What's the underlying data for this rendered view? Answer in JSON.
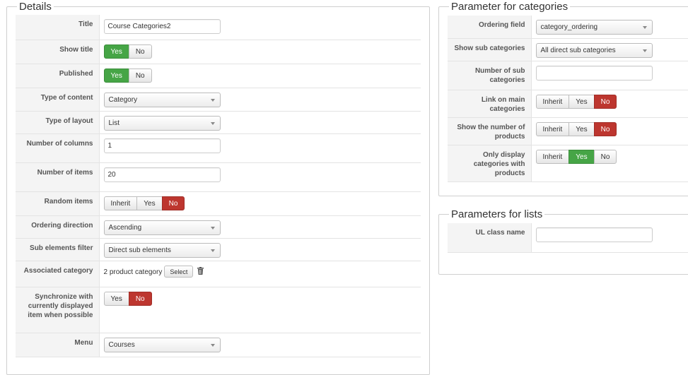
{
  "details": {
    "legend": "Details",
    "title": {
      "label": "Title",
      "value": "Course Categories2"
    },
    "show_title": {
      "label": "Show title",
      "options": [
        "Yes",
        "No"
      ],
      "selected": "Yes"
    },
    "published": {
      "label": "Published",
      "options": [
        "Yes",
        "No"
      ],
      "selected": "Yes"
    },
    "type_of_content": {
      "label": "Type of content",
      "value": "Category"
    },
    "type_of_layout": {
      "label": "Type of layout",
      "value": "List"
    },
    "number_of_columns": {
      "label": "Number of columns",
      "value": "1"
    },
    "number_of_items": {
      "label": "Number of items",
      "value": "20"
    },
    "random_items": {
      "label": "Random items",
      "options": [
        "Inherit",
        "Yes",
        "No"
      ],
      "selected": "No"
    },
    "ordering_direction": {
      "label": "Ordering direction",
      "value": "Ascending"
    },
    "sub_elements_filter": {
      "label": "Sub elements filter",
      "value": "Direct sub elements"
    },
    "associated_category": {
      "label": "Associated category",
      "value": "2 product category",
      "button": "Select"
    },
    "synchronize": {
      "label": "Synchronize with currently displayed item when possible",
      "options": [
        "Yes",
        "No"
      ],
      "selected": "No"
    },
    "menu": {
      "label": "Menu",
      "value": "Courses"
    }
  },
  "categories_params": {
    "legend": "Parameter for categories",
    "ordering_field": {
      "label": "Ordering field",
      "value": "category_ordering"
    },
    "show_sub_categories": {
      "label": "Show sub categories",
      "value": "All direct sub categories"
    },
    "number_of_sub_categories": {
      "label": "Number of sub categories",
      "value": ""
    },
    "link_on_main_categories": {
      "label": "Link on main categories",
      "options": [
        "Inherit",
        "Yes",
        "No"
      ],
      "selected": "No"
    },
    "show_number_of_products": {
      "label": "Show the number of products",
      "options": [
        "Inherit",
        "Yes",
        "No"
      ],
      "selected": "No"
    },
    "only_display_with_products": {
      "label": "Only display categories with products",
      "options": [
        "Inherit",
        "Yes",
        "No"
      ],
      "selected": "Yes"
    }
  },
  "list_params": {
    "legend": "Parameters for lists",
    "ul_class_name": {
      "label": "UL class name",
      "value": ""
    }
  },
  "colors": {
    "yes_active": "#46a546",
    "no_active": "#bd362f"
  }
}
